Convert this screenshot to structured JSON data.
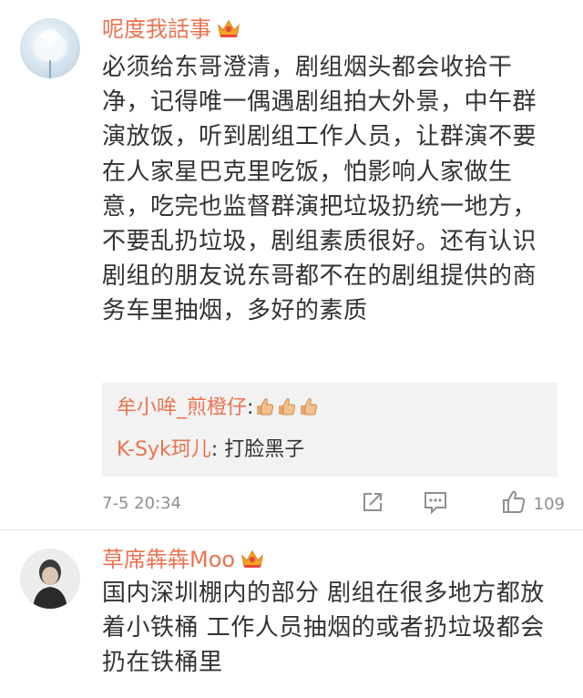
{
  "comments": [
    {
      "username": "呢度我話事",
      "text": "必须给东哥澄清，剧组烟头都会收拾干净，记得唯一偶遇剧组拍大外景，中午群演放饭，听到剧组工作人员，让群演不要在人家星巴克里吃饭，怕影响人家做生意，吃完也监督群演把垃圾扔统一地方，不要乱扔垃圾，剧组素质很好。还有认识剧组的朋友说东哥都不在的剧组提供的商务车里抽烟，多好的素质",
      "replies": [
        {
          "user": "牟小哞_煎橙仔",
          "separator": ":",
          "text": "",
          "icons": [
            "thumbs-up-icon",
            "thumbs-up-icon",
            "thumbs-up-icon"
          ]
        },
        {
          "user": "K-Syk珂儿",
          "separator": ":",
          "text": " 打脸黑子"
        }
      ],
      "time": "7-5 20:34",
      "like_count": "109",
      "icons": {
        "badge": "vip-crown-icon",
        "share": "share-icon",
        "comment": "comment-icon",
        "like": "like-icon"
      }
    },
    {
      "username": "草席犇犇Moo",
      "text": "国内深圳棚内的部分 剧组在很多地方都放着小铁桶 工作人员抽烟的或者扔垃圾都会扔在铁桶里",
      "icons": {
        "badge": "vip-crown-icon"
      }
    }
  ],
  "colors": {
    "username": "#eb7350",
    "text": "#333333",
    "meta": "#8f8f8f",
    "reply_bg": "#f2f2f2"
  }
}
